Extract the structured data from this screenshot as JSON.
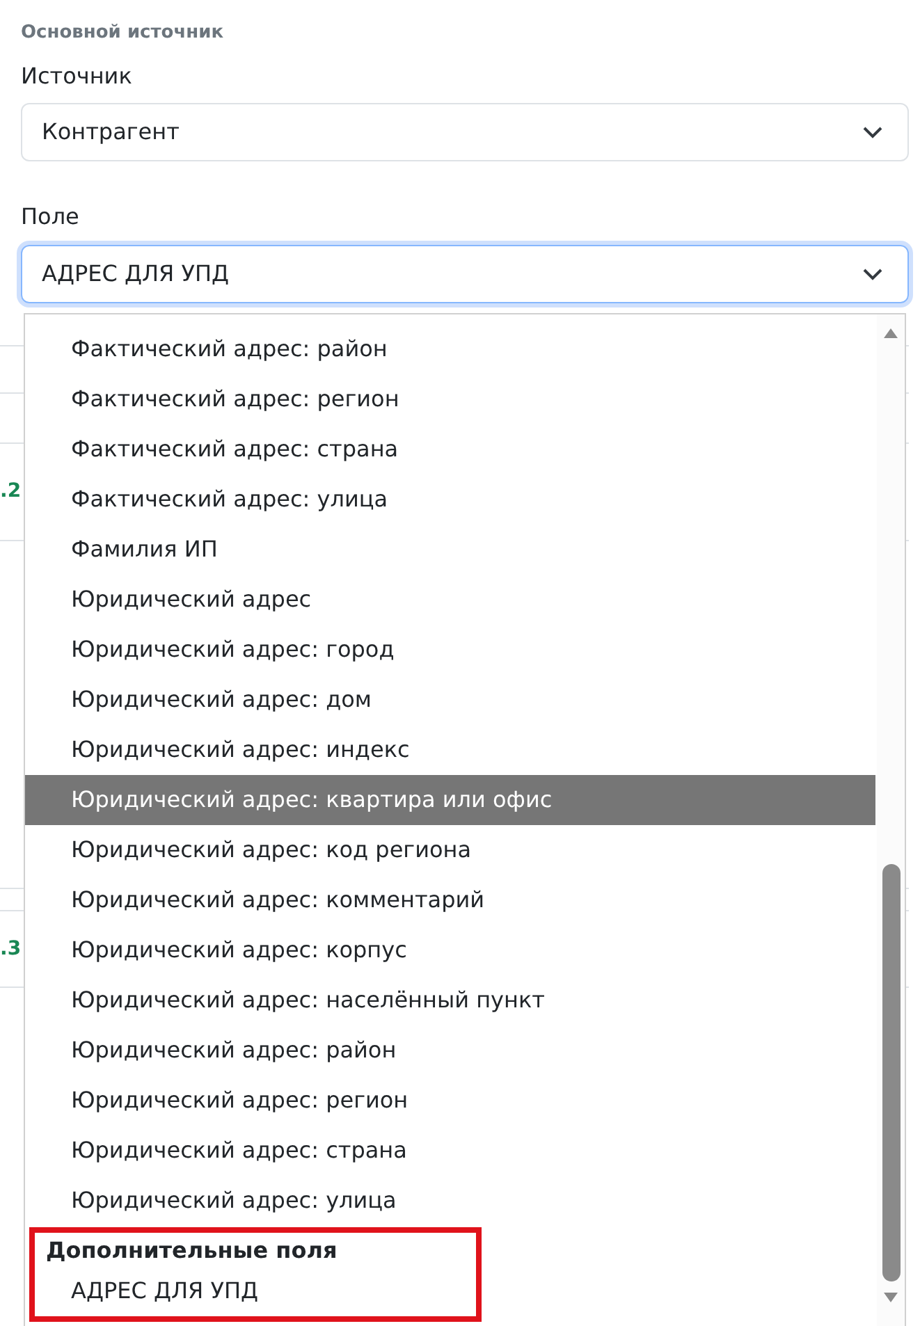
{
  "section_title": "Основной источник",
  "fields": [
    {
      "label": "Источник",
      "value": "Контрагент",
      "focused": false
    },
    {
      "label": "Поле",
      "value": "АДРЕС ДЛЯ УПД",
      "focused": true
    }
  ],
  "background_numbers": [
    ".2",
    ".3"
  ],
  "dropdown": {
    "options": [
      {
        "kind": "option",
        "text": "Фактический адрес: район",
        "selected": false
      },
      {
        "kind": "option",
        "text": "Фактический адрес: регион",
        "selected": false
      },
      {
        "kind": "option",
        "text": "Фактический адрес: страна",
        "selected": false
      },
      {
        "kind": "option",
        "text": "Фактический адрес: улица",
        "selected": false
      },
      {
        "kind": "option",
        "text": "Фамилия ИП",
        "selected": false
      },
      {
        "kind": "option",
        "text": "Юридический адрес",
        "selected": false
      },
      {
        "kind": "option",
        "text": "Юридический адрес: город",
        "selected": false
      },
      {
        "kind": "option",
        "text": "Юридический адрес: дом",
        "selected": false
      },
      {
        "kind": "option",
        "text": "Юридический адрес: индекс",
        "selected": false
      },
      {
        "kind": "option",
        "text": "Юридический адрес: квартира или офис",
        "selected": true
      },
      {
        "kind": "option",
        "text": "Юридический адрес: код региона",
        "selected": false
      },
      {
        "kind": "option",
        "text": "Юридический адрес: комментарий",
        "selected": false
      },
      {
        "kind": "option",
        "text": "Юридический адрес: корпус",
        "selected": false
      },
      {
        "kind": "option",
        "text": "Юридический адрес: населённый пункт",
        "selected": false
      },
      {
        "kind": "option",
        "text": "Юридический адрес: район",
        "selected": false
      },
      {
        "kind": "option",
        "text": "Юридический адрес: регион",
        "selected": false
      },
      {
        "kind": "option",
        "text": "Юридический адрес: страна",
        "selected": false
      },
      {
        "kind": "option",
        "text": "Юридический адрес: улица",
        "selected": false
      },
      {
        "kind": "group",
        "label": "Дополнительные поля",
        "highlighted": true,
        "options": [
          {
            "text": "АДРЕС ДЛЯ УПД",
            "selected": false
          }
        ]
      }
    ]
  }
}
